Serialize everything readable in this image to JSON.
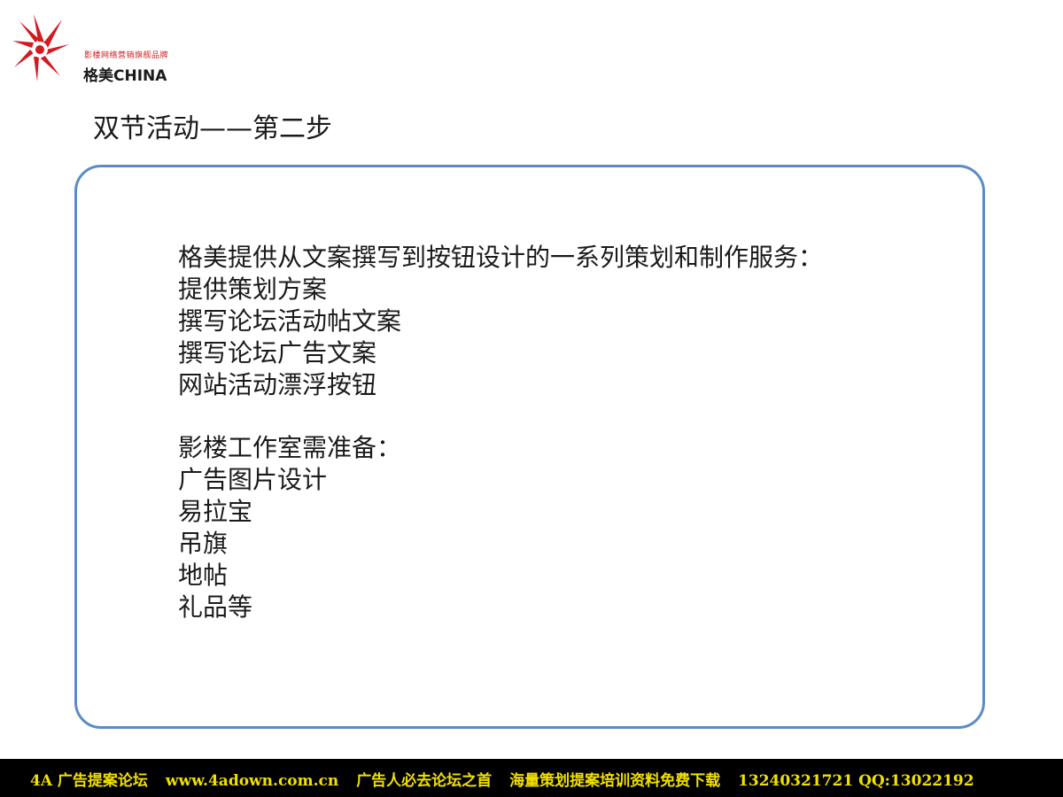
{
  "brand": {
    "tagline": "影楼网络营销旗舰品牌",
    "name": "格美CHINA",
    "accent_color": "#d4191f",
    "logo_icon": "sunburst-logo-icon"
  },
  "slide": {
    "title": "双节活动——第二步"
  },
  "content": {
    "section1": {
      "heading": "格美提供从文案撰写到按钮设计的一系列策划和制作服务：",
      "items": [
        "提供策划方案",
        "撰写论坛活动帖文案",
        "撰写论坛广告文案",
        "网站活动漂浮按钮"
      ]
    },
    "section2": {
      "heading": "影楼工作室需准备：",
      "items": [
        "广告图片设计",
        "易拉宝",
        "吊旗",
        "地帖",
        "礼品等"
      ]
    },
    "box_border_color": "#5b8bc7"
  },
  "footer": {
    "forum": "4A 广告提案论坛",
    "url": "www.4adown.com.cn",
    "slogan": "广告人必去论坛之首",
    "promo": "海量策划提案培训资料免费下载",
    "contact": "13240321721 QQ:13022192",
    "text_color": "#f2e000",
    "background": "#000000"
  }
}
